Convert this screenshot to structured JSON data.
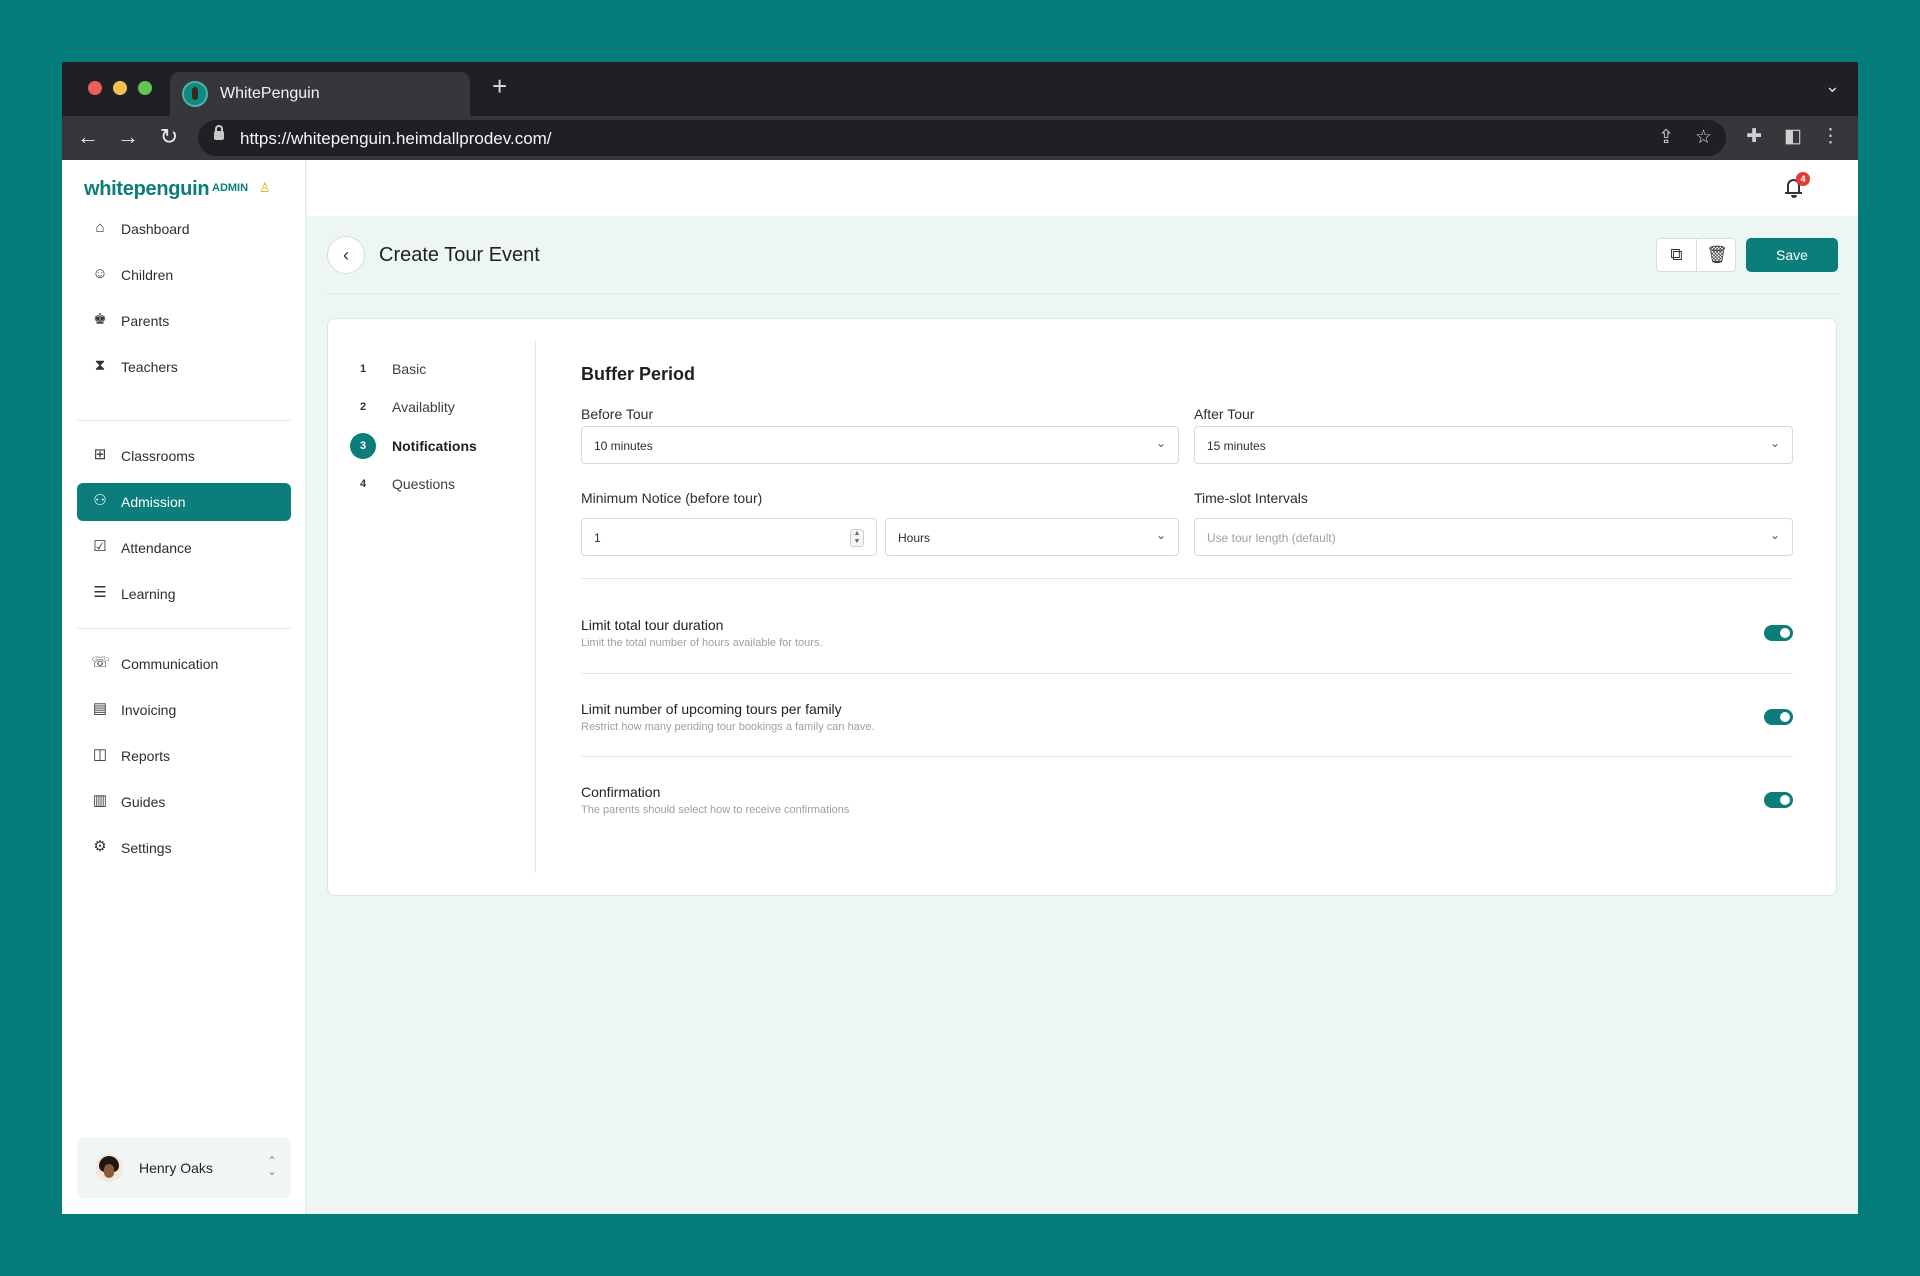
{
  "browser": {
    "tab_title": "WhitePenguin",
    "new_tab": "+",
    "url": "https://whitepenguin.heimdallprodev.com/"
  },
  "brand": {
    "logo_text": "whitepenguin",
    "admin_tag": "ADMIN"
  },
  "sidebar": {
    "items": [
      {
        "label": "Dashboard",
        "icon": "home-icon"
      },
      {
        "label": "Children",
        "icon": "child-icon"
      },
      {
        "label": "Parents",
        "icon": "parents-icon"
      },
      {
        "label": "Teachers",
        "icon": "teacher-icon"
      },
      {
        "label": "Classrooms",
        "icon": "grid-icon"
      },
      {
        "label": "Admission",
        "icon": "admission-icon"
      },
      {
        "label": "Attendance",
        "icon": "attendance-icon"
      },
      {
        "label": "Learning",
        "icon": "learning-icon"
      },
      {
        "label": "Communication",
        "icon": "chat-icon"
      },
      {
        "label": "Invoicing",
        "icon": "invoice-icon"
      },
      {
        "label": "Reports",
        "icon": "reports-icon"
      },
      {
        "label": "Guides",
        "icon": "guides-icon"
      },
      {
        "label": "Settings",
        "icon": "gear-icon"
      }
    ],
    "active": "Admission"
  },
  "user": {
    "name": "Henry Oaks"
  },
  "notifications": {
    "count": "4"
  },
  "header": {
    "title": "Create Tour Event",
    "save_label": "Save"
  },
  "steps": [
    {
      "num": "1",
      "label": "Basic"
    },
    {
      "num": "2",
      "label": "Availablity"
    },
    {
      "num": "3",
      "label": "Notifications"
    },
    {
      "num": "4",
      "label": "Questions"
    }
  ],
  "active_step": "3",
  "form": {
    "section_title": "Buffer Period",
    "before_tour": {
      "label": "Before Tour",
      "value": "10 minutes"
    },
    "after_tour": {
      "label": "After Tour",
      "value": "15 minutes"
    },
    "min_notice": {
      "label": "Minimum Notice (before tour)",
      "value": "1",
      "unit": "Hours"
    },
    "timeslot": {
      "label": "Time-slot Intervals",
      "placeholder": "Use tour length (default)"
    }
  },
  "toggles": [
    {
      "title": "Limit total tour duration",
      "desc": "Limit the total number of hours available for tours.",
      "on": true
    },
    {
      "title": "Limit number of upcoming tours per family",
      "desc": "Restrict how many pending tour bookings a family can have.",
      "on": true
    },
    {
      "title": "Confirmation",
      "desc": "The parents should select how to receive confirmations",
      "on": true
    }
  ],
  "colors": {
    "accent": "#0b7d7a",
    "backdrop": "#047c7c",
    "badge": "#e53935"
  }
}
